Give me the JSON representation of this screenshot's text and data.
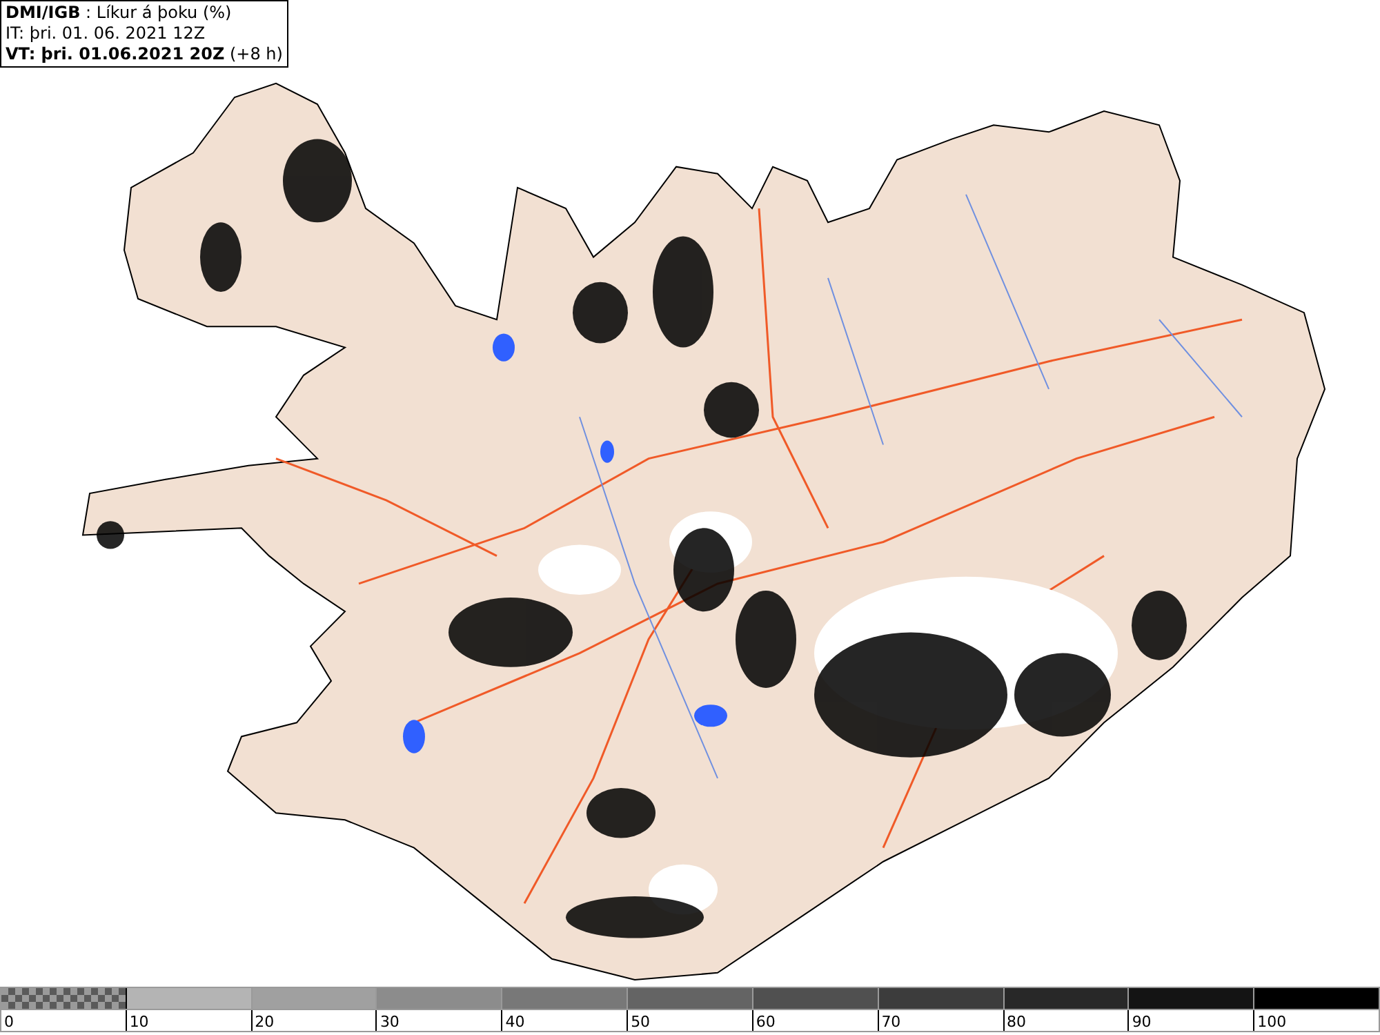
{
  "title_box": {
    "lines": [
      "**DMI/IGB** : Líkur á þoku (%)",
      "IT: þri. 01. 06. 2021 12Z",
      "**VT: þri. 01.06.2021 20Z** (+8 h)"
    ]
  },
  "legend": [
    {
      "kind": "pattern",
      "label": "0"
    },
    {
      "kind": "solid",
      "label": "10",
      "color": "#b4b4b4"
    },
    {
      "kind": "solid",
      "label": "20",
      "color": "#a0a0a0"
    },
    {
      "kind": "solid",
      "label": "30",
      "color": "#8c8c8c"
    },
    {
      "kind": "solid",
      "label": "40",
      "color": "#787878"
    },
    {
      "kind": "solid",
      "label": "50",
      "color": "#646464"
    },
    {
      "kind": "solid",
      "label": "60",
      "color": "#505050"
    },
    {
      "kind": "solid",
      "label": "70",
      "color": "#3c3c3c"
    },
    {
      "kind": "solid",
      "label": "80",
      "color": "#282828"
    },
    {
      "kind": "solid",
      "label": "90",
      "color": "#141414"
    },
    {
      "kind": "solid",
      "label": "100",
      "color": "#000000"
    }
  ]
}
